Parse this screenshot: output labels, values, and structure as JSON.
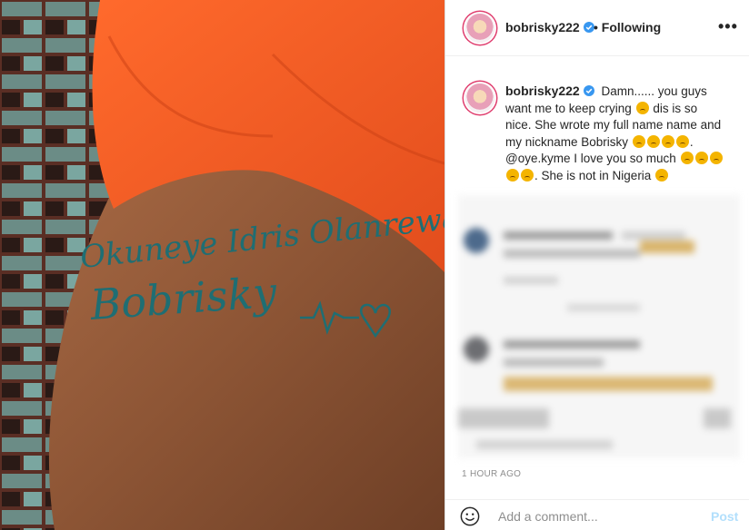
{
  "post": {
    "username": "bobrisky222",
    "follow_status": "Following",
    "more_glyph": "•••",
    "caption_part1": "Damn...... you guys want me to keep crying",
    "caption_part2": "dis is so nice. She wrote my full name name and my nickname Bobrisky",
    "caption_mention": "@oye.kyme",
    "caption_part3": "I love you so much",
    "caption_part4": ". She is not in Nigeria",
    "timestamp": "1 HOUR AGO",
    "comment_placeholder": "Add a comment...",
    "post_label": "Post"
  },
  "tattoo": {
    "line1": "Okuneye Idris Olanrewaju",
    "line2": "Bobrisky"
  },
  "colors": {
    "verified": "#3897f0",
    "post_disabled": "#b2dffc",
    "shirt": "#f05a28",
    "skin": "#8a5030",
    "ink": "#1f6e73"
  }
}
